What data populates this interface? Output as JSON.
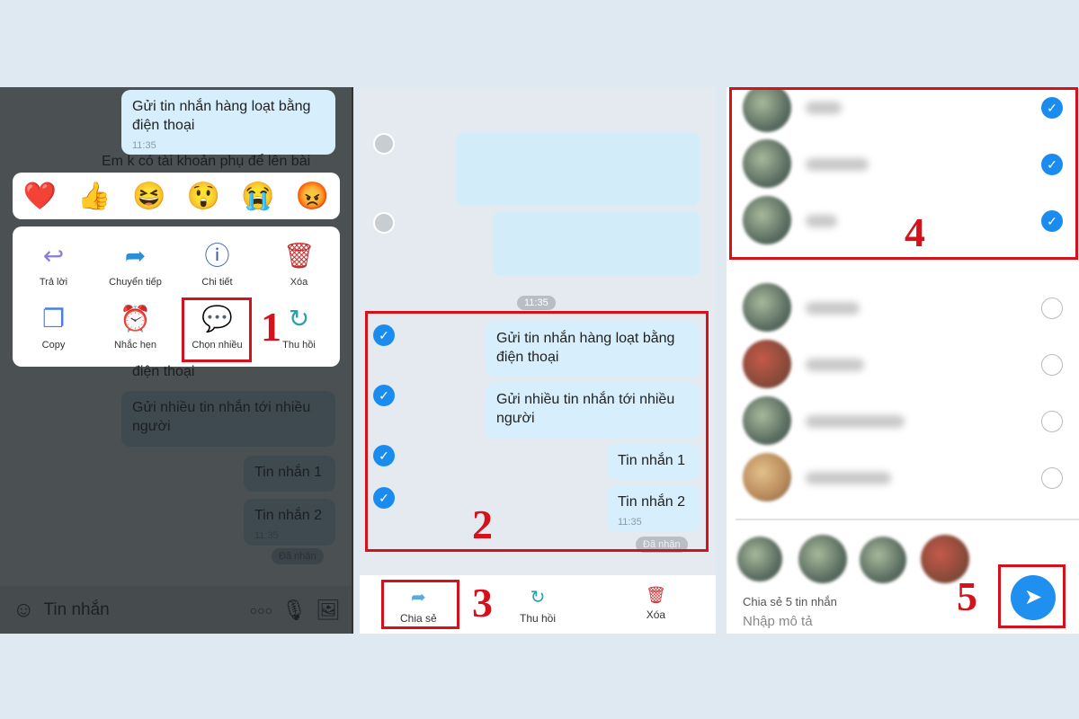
{
  "panel1": {
    "top_message": {
      "text": "Gửi tin nhắn hàng loạt bằng điện thoại",
      "time": "11:35"
    },
    "incoming_message": "Em k có tài khoản phụ để lên bài",
    "reactions": [
      "heart",
      "thumbs-up",
      "laughing",
      "surprised",
      "crying",
      "angry"
    ],
    "reaction_glyphs": [
      "❤️",
      "👍",
      "😆",
      "😲",
      "😭",
      "😡"
    ],
    "menu": [
      {
        "label": "Trả lời",
        "icon": "reply-icon",
        "glyph": "↩"
      },
      {
        "label": "Chuyển tiếp",
        "icon": "forward-icon",
        "glyph": "➦"
      },
      {
        "label": "Chi tiết",
        "icon": "info-icon",
        "glyph": "ⓘ"
      },
      {
        "label": "Xóa",
        "icon": "trash-icon",
        "glyph": "🗑"
      },
      {
        "label": "Copy",
        "icon": "copy-icon",
        "glyph": "❐"
      },
      {
        "label": "Nhắc hẹn",
        "icon": "alarm-icon",
        "glyph": "⏰"
      },
      {
        "label": "Chọn nhiều",
        "icon": "multi-select-icon",
        "glyph": "💬"
      },
      {
        "label": "Thu hồi",
        "icon": "recall-icon",
        "glyph": "↻"
      }
    ],
    "bg_messages": [
      "điện thoại",
      "Gửi nhiều tin nhắn tới nhiều người",
      "Tin nhắn 1",
      "Tin nhắn 2"
    ],
    "bg_time": "11:35",
    "received_status": "Đã nhận",
    "input_placeholder": "Tin nhắn",
    "step": "1"
  },
  "panel2": {
    "time_divider": "11:35",
    "selected_messages": [
      {
        "text": "Gửi tin nhắn hàng loạt bằng điện thoại"
      },
      {
        "text": "Gửi nhiều tin nhắn tới nhiều người"
      },
      {
        "text": "Tin nhắn 1"
      },
      {
        "text": "Tin nhắn 2",
        "time": "11:35"
      }
    ],
    "received_status": "Đã nhận",
    "toolbar": {
      "share": "Chia sẻ",
      "recall": "Thu hồi",
      "delete": "Xóa"
    },
    "step_select": "2",
    "step_share": "3"
  },
  "panel3": {
    "contacts_checked": [
      true,
      true,
      true,
      false,
      false,
      false,
      false
    ],
    "share_summary": "Chia sẻ 5 tin nhắn",
    "description_placeholder": "Nhập mô tả",
    "step_contacts": "4",
    "step_send": "5"
  },
  "colors": {
    "accent": "#1a8cf0",
    "annotation": "#d5121b",
    "bubble": "#d7eefc"
  }
}
